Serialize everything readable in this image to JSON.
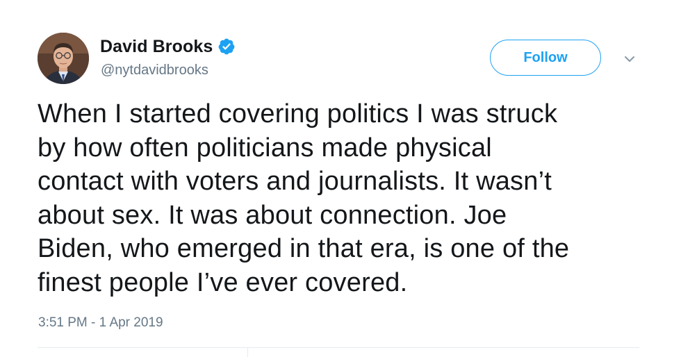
{
  "user": {
    "display_name": "David Brooks",
    "handle": "@nytdavidbrooks",
    "verified": true,
    "verified_icon": "verified-badge-icon",
    "avatar_icon": "profile-photo"
  },
  "actions": {
    "follow_label": "Follow",
    "more_icon": "chevron-down-icon"
  },
  "tweet": {
    "text": "When I started covering politics I was struck\nby how often politicians made physical\ncontact with voters and journalists. It wasn’t\nabout sex. It was about connection. Joe\nBiden, who emerged in that era, is one of the\nfinest people I’ve ever covered.",
    "timestamp": "3:51 PM - 1 Apr 2019"
  },
  "colors": {
    "accent": "#1da1f2",
    "text": "#14171a",
    "secondary_text": "#657786",
    "divider": "#e6ecf0"
  }
}
